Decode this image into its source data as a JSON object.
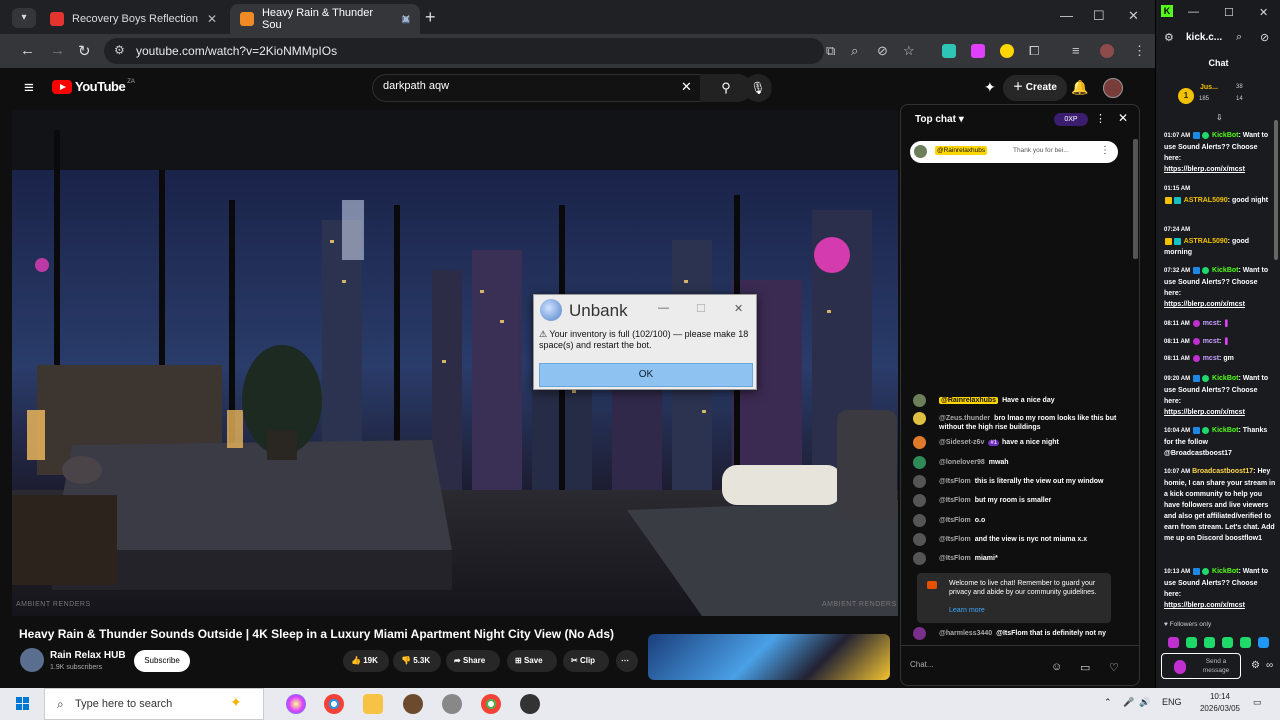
{
  "browser": {
    "tabs": [
      {
        "title": "Recovery Boys Reflection"
      },
      {
        "title": "Heavy Rain & Thunder Sou"
      }
    ],
    "url": "youtube.com/watch?v=2KioNMMpIOs"
  },
  "youtube": {
    "logo_text": "YouTube",
    "country": "ZA",
    "search_value": "darkpath aqw",
    "create_label": "Create",
    "video_watermark_left": "AMBIENT RENDERS",
    "video_watermark_right": "AMBIENT RENDERS",
    "video_title": "Heavy Rain & Thunder Sounds Outside | 4K Sleep in a Luxury Miami Apartment Night City View (No Ads)",
    "channel_name": "Rain Relax HUB",
    "channel_subs": "1.9K subscribers",
    "subscribe_label": "Subscribe",
    "likes": "19K",
    "dislikes": "5.3K",
    "share_label": "Share",
    "save_label": "Save",
    "clip_label": "Clip"
  },
  "dialog": {
    "title": "Unbank",
    "message": "Your inventory is full (102/100) — please make 18 space(s) and restart the bot.",
    "ok_label": "OK"
  },
  "live_chat": {
    "header": "Top chat",
    "xp_badge": "0XP",
    "pinned_user": "@Rainrelaxhubs",
    "pinned_text": "Thank you for bei...",
    "messages": [
      {
        "user": "@Rainrelaxhubs",
        "text": "Have a nice day"
      },
      {
        "user": "@Zeus.thunder",
        "text": "bro lmao my room looks like this but without the high rise buildings"
      },
      {
        "user": "@Sideset-z6v",
        "badge": "#1",
        "text": "have a nice night"
      },
      {
        "user": "@lonelover98",
        "text": "mwah"
      },
      {
        "user": "@ItsFlom",
        "text": "this is literally the view out my window"
      },
      {
        "user": "@ItsFlom",
        "text": "but my room is smaller"
      },
      {
        "user": "@ItsFlom",
        "text": "o.o"
      },
      {
        "user": "@ItsFlom",
        "text": "and the view is nyc not miama x.x"
      },
      {
        "user": "@ItsFlom",
        "text": "miami*"
      }
    ],
    "notice_text": "Welcome to live chat! Remember to guard your privacy and abide by our community guidelines.",
    "learn_more": "Learn more",
    "last_message_user": "@harmless3440",
    "last_message_text": "@ItsFlom that is definitely not ny",
    "input_placeholder": "Chat..."
  },
  "kick": {
    "url": "kick.c...",
    "chat_title": "Chat",
    "top_user": "Jus...",
    "top_n1": "185",
    "top_n2": "38",
    "top_n3": "14",
    "messages": [
      {
        "time": "01:07 AM",
        "user": "KickBot",
        "cls": "kname",
        "text": "Want to use Sound Alerts?? Choose here:",
        "link": "https://blerp.com/x/mcst"
      },
      {
        "time": "01:15 AM",
        "user": "ASTRAL5090",
        "cls": "aname",
        "text": "good night",
        "link": ""
      },
      {
        "time": "07:24 AM",
        "user": "ASTRAL5090",
        "cls": "aname",
        "text": "good morning",
        "link": ""
      },
      {
        "time": "07:32 AM",
        "user": "KickBot",
        "cls": "kname",
        "text": "Want to use Sound Alerts?? Choose here:",
        "link": "https://blerp.com/x/mcst"
      },
      {
        "time": "08:11 AM",
        "user": "mcst",
        "cls": "mname",
        "text": "",
        "link": ""
      },
      {
        "time": "08:11 AM",
        "user": "mcst",
        "cls": "mname",
        "text": "",
        "link": ""
      },
      {
        "time": "08:11 AM",
        "user": "mcst",
        "cls": "mname",
        "text": "gm",
        "link": ""
      },
      {
        "time": "09:20 AM",
        "user": "KickBot",
        "cls": "kname",
        "text": "Want to use Sound Alerts?? Choose here:",
        "link": "https://blerp.com/x/mcst"
      },
      {
        "time": "10:04 AM",
        "user": "KickBot",
        "cls": "kname",
        "text": "Thanks for the follow @Broadcastboost17",
        "link": ""
      },
      {
        "time": "10:07 AM",
        "user": "Broadcastboost17",
        "cls": "bname",
        "text": "Hey homie, I can share your stream in a kick community to help you have followers and live viewers and also get affiliated/verified to earn from stream. Let's chat. Add me up on Discord boostflow1",
        "link": ""
      },
      {
        "time": "10:13 AM",
        "user": "KickBot",
        "cls": "kname",
        "text": "Want to use Sound Alerts?? Choose here:",
        "link": "https://blerp.com/x/mcst"
      }
    ],
    "followers_only": "Followers only",
    "send_label": "Send a message"
  },
  "taskbar": {
    "search_placeholder": "Type here to search",
    "lang": "ENG",
    "time": "10:14",
    "date": "2026/03/05"
  }
}
